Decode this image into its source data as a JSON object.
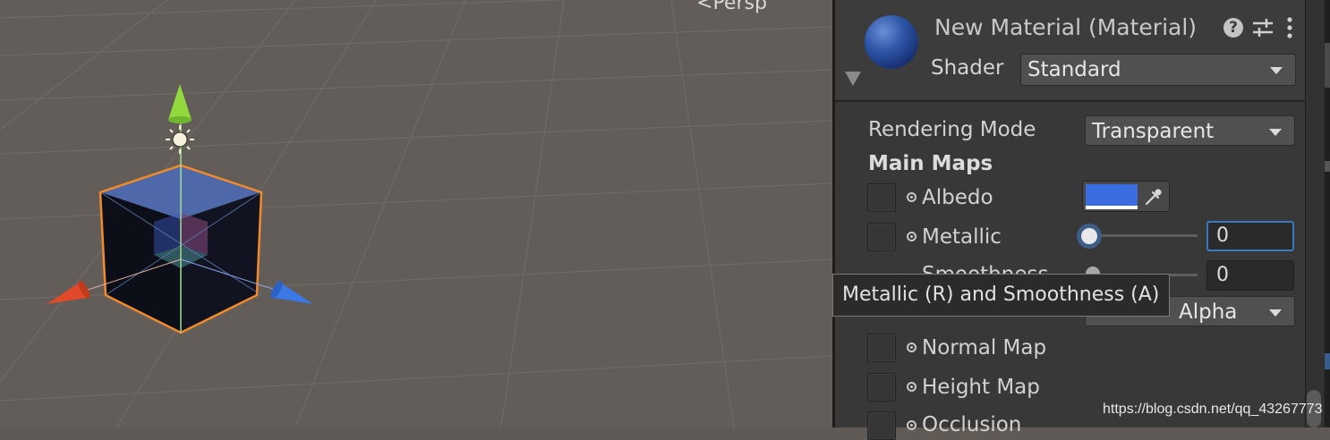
{
  "scene": {
    "view_label": "Persp"
  },
  "inspector": {
    "material_title": "New Material (Material)",
    "shader_label": "Shader",
    "shader_value": "Standard",
    "rendering_mode_label": "Rendering Mode",
    "rendering_mode_value": "Transparent",
    "section_main_maps": "Main Maps",
    "albedo_label": "Albedo",
    "albedo_color": "#3a6ee0",
    "metallic_label": "Metallic",
    "metallic_value": "0",
    "smoothness_label": "Smoothness",
    "smoothness_value": "0",
    "source_value": "Alpha",
    "normal_map_label": "Normal Map",
    "height_map_label": "Height Map",
    "occlusion_label": "Occlusion"
  },
  "tooltip": {
    "text": "Metallic (R) and Smoothness (A)"
  },
  "watermark": "https://blog.csdn.net/qq_43267773",
  "icons": [
    "help-icon",
    "sliders-icon",
    "more-icon",
    "eyedropper-icon",
    "picker-icon",
    "foldout-arrow-icon",
    "sun-icon"
  ]
}
